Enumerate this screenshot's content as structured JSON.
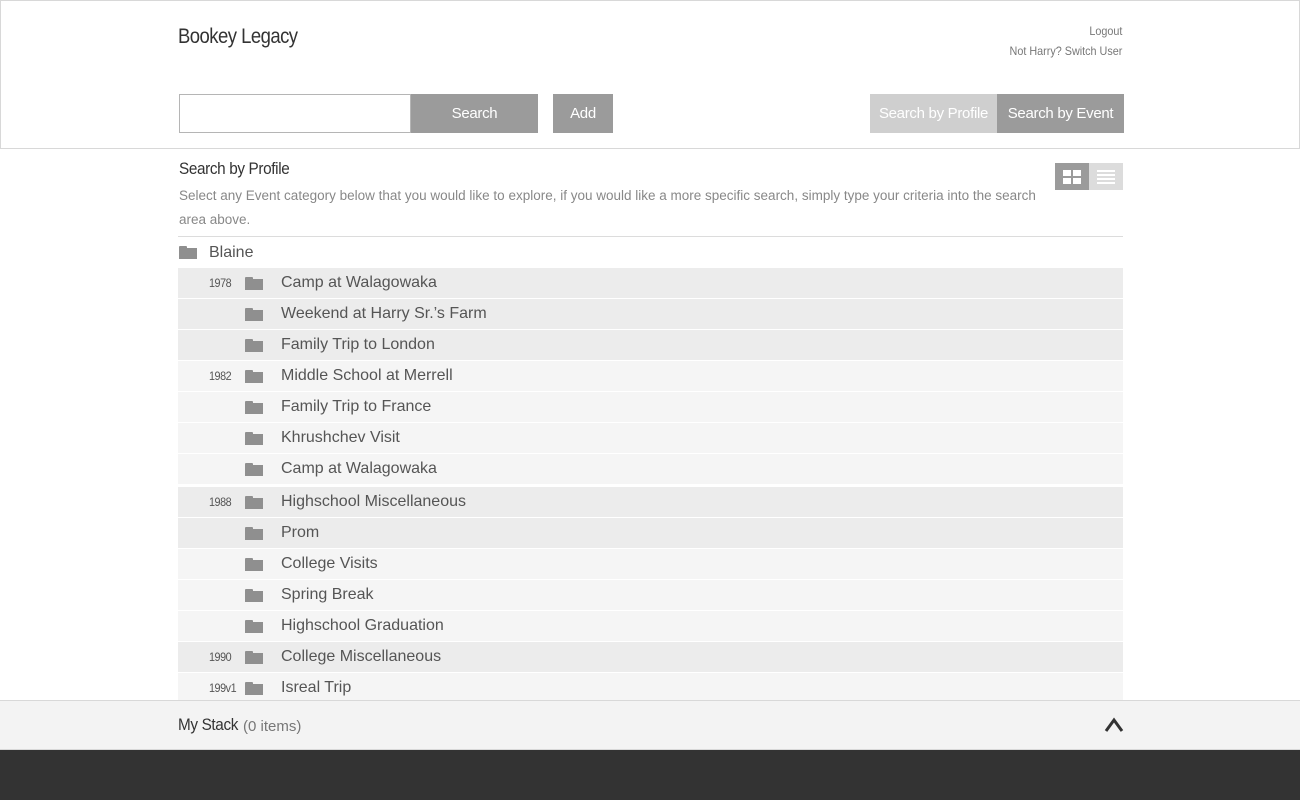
{
  "header": {
    "brand": "Bookey Legacy",
    "logout": "Logout",
    "switch_user": "Not Harry? Switch User"
  },
  "searchbar": {
    "input_value": "",
    "input_placeholder": "",
    "search_label": "Search",
    "add_label": "Add",
    "profile_label": "Search by Profile",
    "event_label": "Search by Event"
  },
  "main": {
    "title": "Search by Profile",
    "description": "Select any Event category below that you would like to explore, if you would like a more specific search, simply type your criteria into the search area above.",
    "view_grid_icon": "grid-view-icon",
    "view_list_icon": "list-view-icon",
    "root": {
      "icon": "folder-icon",
      "label": "Blaine"
    },
    "events": [
      {
        "year": "1978",
        "label": "Camp at Walagowaka"
      },
      {
        "year": "",
        "label": "Weekend at Harry Sr.’s Farm"
      },
      {
        "year": "",
        "label": "Family Trip to London"
      },
      {
        "year": "1982",
        "label": "Middle School at Merrell"
      },
      {
        "year": "",
        "label": "Family Trip to France"
      },
      {
        "year": "",
        "label": "Khrushchev Visit"
      },
      {
        "year": "",
        "label": "Camp at Walagowaka"
      },
      {
        "year": "1988",
        "label": "Highschool Miscellaneous"
      },
      {
        "year": "",
        "label": "Prom"
      },
      {
        "year": "",
        "label": "College Visits"
      },
      {
        "year": "",
        "label": "Spring Break"
      },
      {
        "year": "",
        "label": "Highschool Graduation"
      },
      {
        "year": "1990",
        "label": "College Miscellaneous"
      },
      {
        "year": "199v1",
        "label": "Isreal Trip"
      }
    ]
  },
  "stack": {
    "title": "My Stack",
    "count": "(0 items)",
    "toggle_icon": "chevron-up-icon"
  },
  "colors": {
    "button_gray": "#9b9b9b",
    "button_light": "#cfcfcf",
    "row_dark": "#ececec",
    "row_light": "#f5f5f5",
    "footer": "#333333"
  }
}
